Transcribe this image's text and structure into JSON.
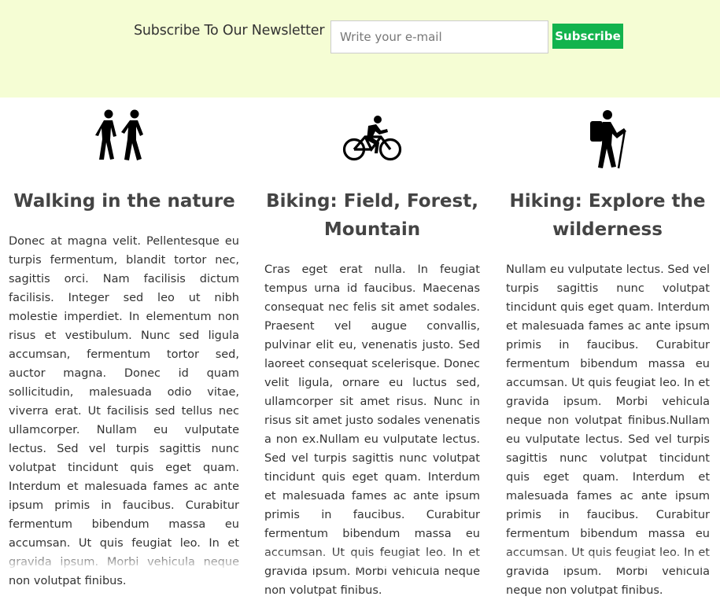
{
  "newsletter": {
    "label": "Subscribe To Our Newsletter",
    "email_placeholder": "Write your e-mail",
    "button_label": "Subscribe"
  },
  "columns": [
    {
      "icon": "walking-people-icon",
      "title": "Walking in the nature",
      "text": "Donec at magna velit. Pellentesque eu turpis fermentum, blandit tortor nec, sagittis orci. Nam facilisis dictum facilisis. Integer sed leo ut nibh molestie imperdiet. In elementum non risus et vestibulum. Nunc sed ligula accumsan, fermentum tortor sed, auctor magna. Donec id quam sollicitudin, malesuada odio vitae, viverra erat. Ut facilisis sed tellus nec ullamcorper. Nullam eu vulputate lectus. Sed vel turpis sagittis nunc volutpat tincidunt quis eget quam. Interdum et malesuada fames ac ante ipsum primis in faucibus. Curabitur fermentum bibendum massa eu accumsan. Ut quis feugiat leo. In et gravida ipsum. Morbi vehicula neque non volutpat finibus."
    },
    {
      "icon": "cyclist-icon",
      "title": "Biking: Field, Forest, Mountain",
      "text": "Cras eget erat nulla. In feugiat tempus urna id faucibus. Maecenas consequat nec felis sit amet sodales. Praesent vel augue convallis, pulvinar elit eu, venenatis justo. Sed laoreet consequat scelerisque. Donec velit ligula, ornare eu luctus sed, ullamcorper sit amet risus. Nunc in risus sit amet justo sodales venenatis a non ex.Nullam eu vulputate lectus. Sed vel turpis sagittis nunc volutpat tincidunt quis eget quam. Interdum et malesuada fames ac ante ipsum primis in faucibus. Curabitur fermentum bibendum massa eu accumsan. Ut quis feugiat leo. In et gravida ipsum. Morbi vehicula neque non volutpat finibus."
    },
    {
      "icon": "hiker-icon",
      "title": "Hiking: Explore the wilderness",
      "text": "Nullam eu vulputate lectus. Sed vel turpis sagittis nunc volutpat tincidunt quis eget quam. Interdum et malesuada fames ac ante ipsum primis in faucibus. Curabitur fermentum bibendum massa eu accumsan. Ut quis feugiat leo. In et gravida ipsum. Morbi vehicula neque non volutpat finibus.Nullam eu vulputate lectus. Sed vel turpis sagittis nunc volutpat tincidunt quis eget quam. Interdum et malesuada fames ac ante ipsum primis in faucibus. Curabitur fermentum bibendum massa eu accumsan. Ut quis feugiat leo. In et gravida ipsum. Morbi vehicula neque non volutpat finibus."
    }
  ]
}
